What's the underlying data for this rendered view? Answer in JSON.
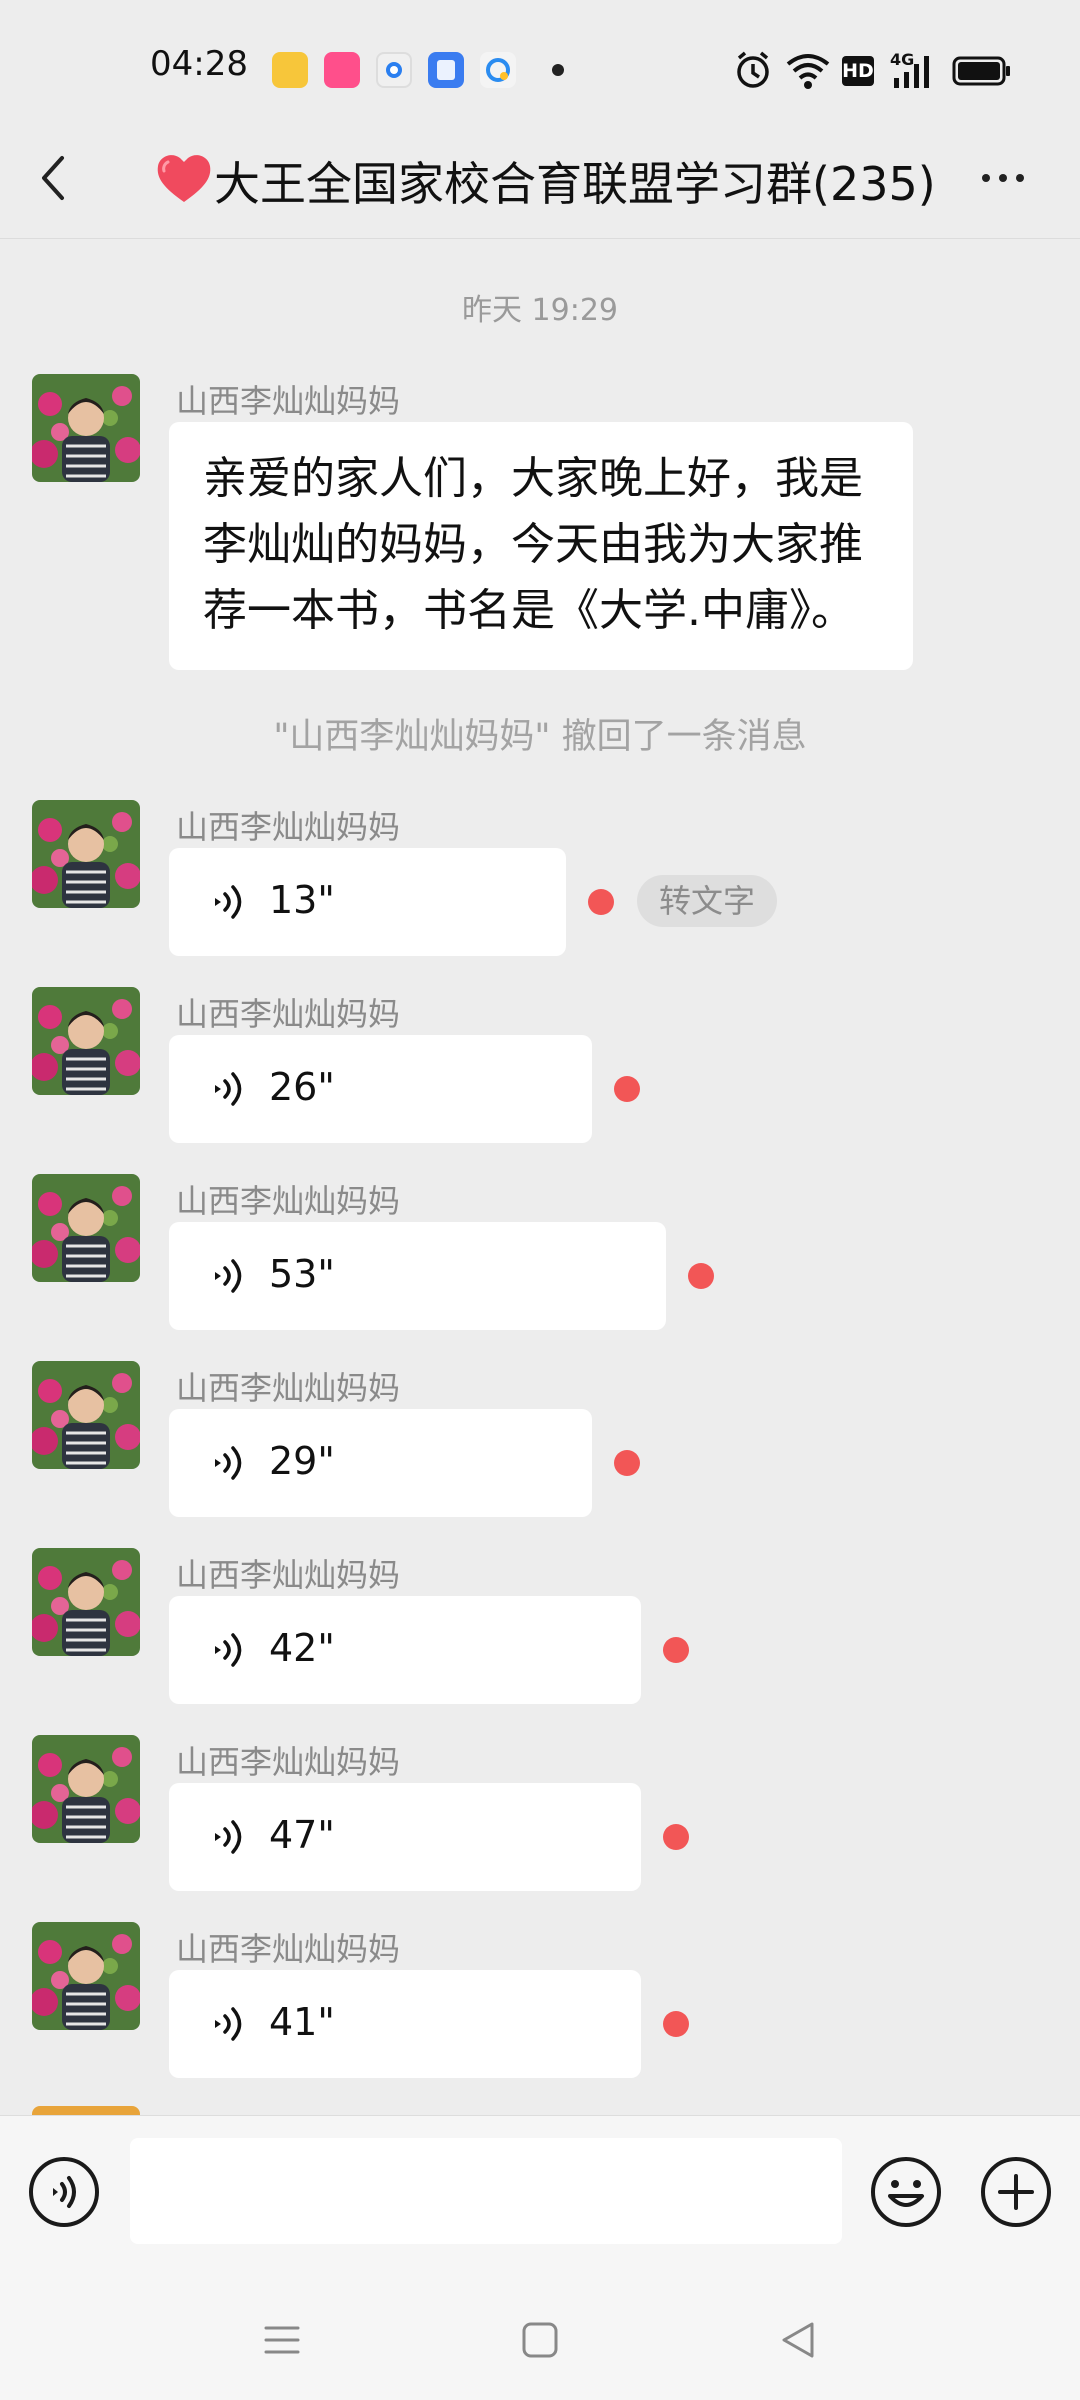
{
  "status_bar": {
    "time": "04:28",
    "icons": [
      "notes-app-icon",
      "shop-app-icon",
      "browser-app-icon",
      "files-app-icon",
      "qq-browser-app-icon",
      "more-notifications-dot",
      "alarm-icon",
      "wifi-icon",
      "hd-icon",
      "signal-4g-icon",
      "battery-icon"
    ],
    "hd_label": "HD",
    "net_label": "4G"
  },
  "header": {
    "title": "大王全国家校合育联盟学习群(235)",
    "title_icon": "heart-icon",
    "back_icon": "back-arrow-icon",
    "more_icon": "more-dots-icon"
  },
  "chat": {
    "timestamp": "昨天 19:29",
    "text_message": {
      "sender": "山西李灿灿妈妈",
      "text": "亲爱的家人们，大家晚上好，我是李灿灿的妈妈，今天由我为大家推荐一本书，书名是《大学.中庸》。"
    },
    "recall_notice": "\"山西李灿灿妈妈\" 撤回了一条消息",
    "convert_to_text_label": "转文字",
    "voice_messages": [
      {
        "sender": "山西李灿灿妈妈",
        "duration": "13\"",
        "unread": true
      },
      {
        "sender": "山西李灿灿妈妈",
        "duration": "26\"",
        "unread": true
      },
      {
        "sender": "山西李灿灿妈妈",
        "duration": "53\"",
        "unread": true
      },
      {
        "sender": "山西李灿灿妈妈",
        "duration": "29\"",
        "unread": true
      },
      {
        "sender": "山西李灿灿妈妈",
        "duration": "42\"",
        "unread": true
      },
      {
        "sender": "山西李灿灿妈妈",
        "duration": "47\"",
        "unread": true
      },
      {
        "sender": "山西李灿灿妈妈",
        "duration": "41\"",
        "unread": true
      }
    ]
  },
  "input_bar": {
    "voice_icon": "voice-input-icon",
    "emoji_icon": "emoji-icon",
    "add_icon": "plus-icon",
    "value": ""
  },
  "nav_bar": {
    "icons": [
      "menu-icon",
      "home-icon",
      "back-icon"
    ]
  },
  "colors": {
    "background": "#ededed",
    "unread_dot": "#f25656",
    "bubble": "#ffffff"
  }
}
